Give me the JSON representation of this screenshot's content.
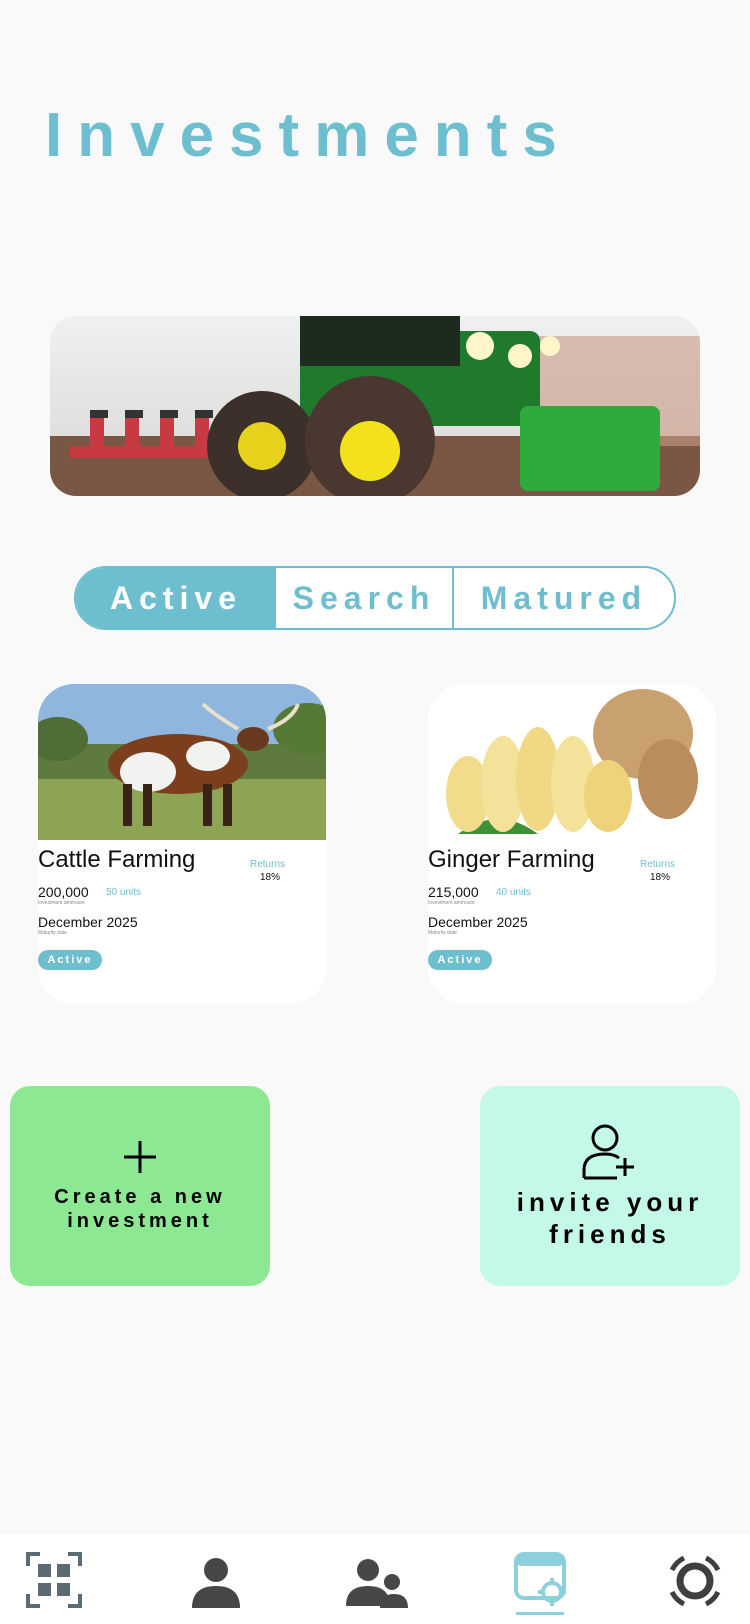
{
  "page": {
    "title": "Investments"
  },
  "tabs": [
    {
      "label": "Active"
    },
    {
      "label": "Search"
    },
    {
      "label": "Matured"
    }
  ],
  "cards": [
    {
      "name": "Cattle Farming",
      "returns_label": "Returns",
      "returns_value": "18%",
      "amount": "200,000",
      "units": "50 units",
      "amount_caption": "Investment ammount",
      "date": "December 2025",
      "date_caption": "Maturity date",
      "status": "Active"
    },
    {
      "name": "Ginger Farming",
      "returns_label": "Returns",
      "returns_value": "18%",
      "amount": "215,000",
      "units": "40 units",
      "amount_caption": "Investment ammount",
      "date": "December 2025",
      "date_caption": "Maturity date",
      "status": "Active"
    }
  ],
  "actions": {
    "create_label": "Create a new investment",
    "invite_label": "invite your friends"
  },
  "nav": {
    "items": [
      "dashboard-icon",
      "profile-icon",
      "group-icon",
      "invest-icon",
      "settings-icon"
    ],
    "active_index": 3
  },
  "colors": {
    "accent": "#6dbfcf",
    "create_bg": "#8ce893",
    "invite_bg": "#c4f8e8",
    "background": "#f9f9f9"
  }
}
